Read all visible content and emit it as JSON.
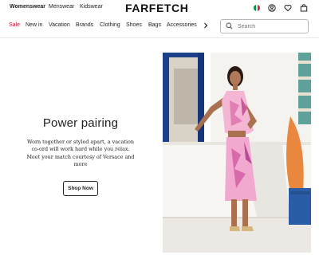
{
  "header": {
    "departments": [
      {
        "label": "Womenswear",
        "active": true
      },
      {
        "label": "Menswear",
        "active": false
      },
      {
        "label": "Kidswear",
        "active": false
      }
    ],
    "logo": "FARFETCH",
    "icons": [
      "italy-flag-icon",
      "account-icon",
      "wishlist-heart-icon",
      "shopping-bag-icon"
    ]
  },
  "nav": {
    "items": [
      "Sale",
      "New in",
      "Vacation",
      "Brands",
      "Clothing",
      "Shoes",
      "Bags",
      "Accessories"
    ],
    "more_icon": "chevron-right-icon",
    "sale_color": "#c8102e"
  },
  "search": {
    "placeholder": "Search",
    "value": ""
  },
  "hero": {
    "title": "Power pairing",
    "copy": "Worn together or styled apart, a vacation co-ord will work hard while you relax. Meet your match courtesy of Versace and more",
    "cta_label": "Shop Now",
    "image": "model-in-pink-printed-co-ord"
  }
}
